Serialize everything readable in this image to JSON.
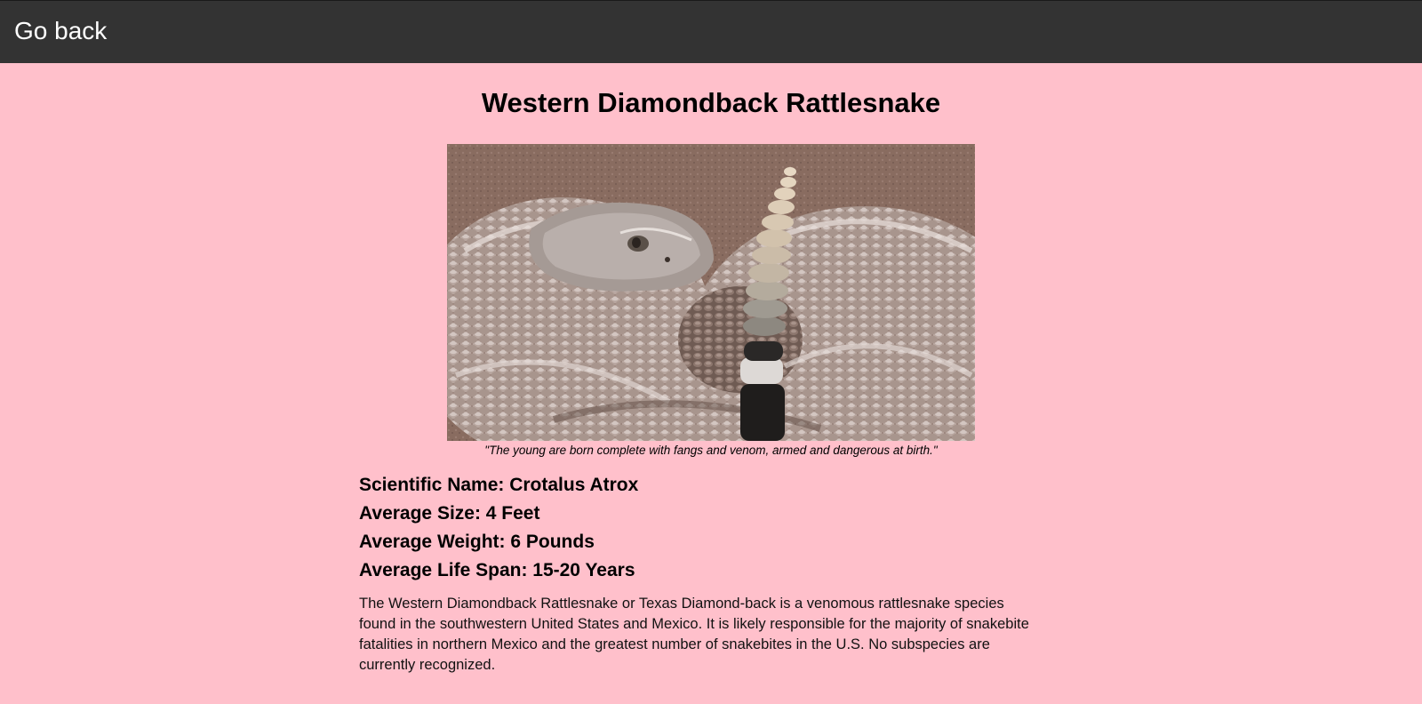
{
  "header": {
    "back_label": "Go back"
  },
  "animal": {
    "title": "Western Diamondback Rattlesnake",
    "photo_alt": "snake-photo",
    "caption": "\"The young are born complete with fangs and venom, armed and dangerous at birth.\"",
    "facts": [
      "Scientific Name: Crotalus Atrox",
      "Average Size: 4 Feet",
      "Average Weight: 6 Pounds",
      "Average Life Span: 15-20 Years"
    ],
    "description": "The Western Diamondback Rattlesnake or Texas Diamond-back is a venomous rattlesnake species found in the southwestern United States and Mexico. It is likely responsible for the majority of snakebite fatalities in northern Mexico and the greatest number of snakebites in the U.S. No subspecies are currently recognized."
  },
  "colors": {
    "page_background": "#ffc0cb",
    "header_background": "#333333",
    "header_text": "#ffffff"
  }
}
